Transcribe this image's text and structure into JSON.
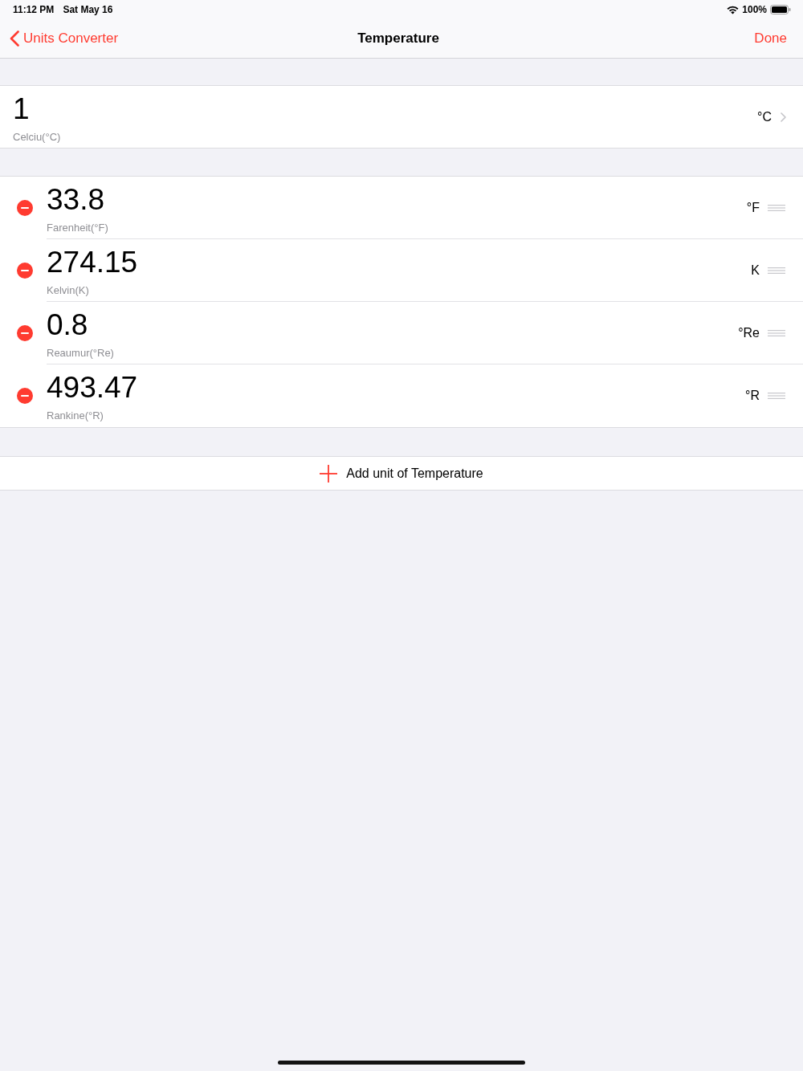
{
  "status_bar": {
    "time": "11:12 PM",
    "date": "Sat May 16",
    "battery": "100%"
  },
  "nav_bar": {
    "back": "Units Converter",
    "title": "Temperature",
    "done": "Done"
  },
  "base_unit": {
    "value": "1",
    "name": "Celciu(°C)",
    "symbol": "°C"
  },
  "units": [
    {
      "value": "33.8",
      "name": "Farenheit(°F)",
      "symbol": "°F"
    },
    {
      "value": "274.15",
      "name": "Kelvin(K)",
      "symbol": "K"
    },
    {
      "value": "0.8",
      "name": "Reaumur(°Re)",
      "symbol": "°Re"
    },
    {
      "value": "493.47",
      "name": "Rankine(°R)",
      "symbol": "°R"
    }
  ],
  "add_button": {
    "label": "Add unit of Temperature"
  }
}
